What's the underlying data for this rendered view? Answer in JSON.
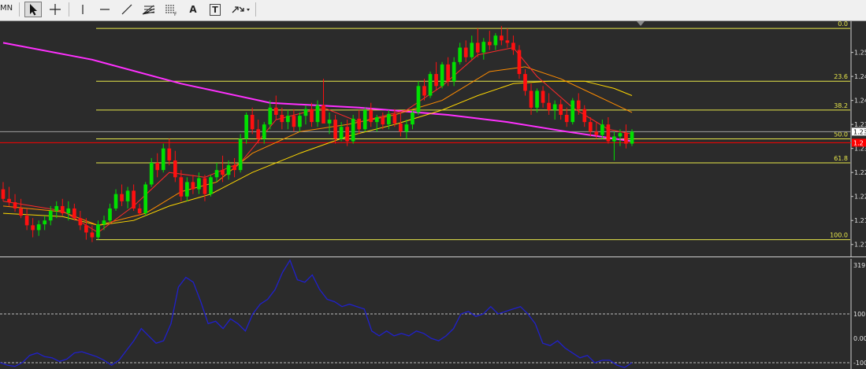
{
  "toolbar": {
    "timeframe_label": "MN",
    "tools": [
      {
        "name": "cursor-arrow-icon"
      },
      {
        "name": "crosshair-icon"
      },
      {
        "name": "vertical-line-icon"
      },
      {
        "name": "trendline-icon"
      },
      {
        "name": "fibonacci-fan-icon"
      },
      {
        "name": "fibonacci-retracement-icon"
      },
      {
        "name": "text-label-icon",
        "label": "A"
      },
      {
        "name": "text-box-icon",
        "label": "T"
      },
      {
        "name": "arrows-dropdown-icon"
      }
    ]
  },
  "colors": {
    "background": "#2b2b2b",
    "bull": "#00e000",
    "bear": "#ff1010",
    "fib": "#e8e84a",
    "ma_slow": "#ff30ff",
    "ma_mid": "#ffd800",
    "ma_fast": "#ff8c00",
    "ma_faster": "#ff2a2a",
    "indicator": "#2020cc",
    "current_price": "#ff0000",
    "ask_line": "#a0a0a0"
  },
  "chart_data": [
    {
      "type": "candlestick",
      "price_axis": {
        "range": [
          1.2085,
          1.257
        ],
        "tick_labels": [
          "1.25",
          "1.24",
          "1.24",
          "1.23",
          "1.23",
          "1.22",
          "1.22",
          "1.21",
          "1.21"
        ],
        "tick_values": [
          1.251,
          1.246,
          1.241,
          1.236,
          1.231,
          1.226,
          1.221,
          1.216,
          1.211
        ],
        "current_price_label": "1.2"
      },
      "current_price": 1.2322,
      "ask_price": 1.2345,
      "fibonacci": [
        {
          "label": "0.0",
          "price": 1.256
        },
        {
          "label": "23.6",
          "price": 1.245
        },
        {
          "label": "38.2",
          "price": 1.239
        },
        {
          "label": "50.0",
          "price": 1.233
        },
        {
          "label": "61.8",
          "price": 1.228
        },
        {
          "label": "100.0",
          "price": 1.212
        }
      ],
      "candles": [
        [
          1.2225,
          1.224,
          1.22,
          1.2205
        ],
        [
          1.2205,
          1.223,
          1.219,
          1.2198
        ],
        [
          1.2198,
          1.2215,
          1.2178,
          1.2185
        ],
        [
          1.2185,
          1.2205,
          1.2165,
          1.217
        ],
        [
          1.217,
          1.2185,
          1.214,
          1.215
        ],
        [
          1.215,
          1.2165,
          1.2125,
          1.214
        ],
        [
          1.214,
          1.216,
          1.2128,
          1.2152
        ],
        [
          1.2152,
          1.217,
          1.214,
          1.216
        ],
        [
          1.216,
          1.219,
          1.215,
          1.218
        ],
        [
          1.218,
          1.22,
          1.2165,
          1.219
        ],
        [
          1.219,
          1.2205,
          1.217,
          1.2175
        ],
        [
          1.2175,
          1.22,
          1.216,
          1.2185
        ],
        [
          1.2185,
          1.2195,
          1.216,
          1.2165
        ],
        [
          1.2165,
          1.218,
          1.214,
          1.215
        ],
        [
          1.215,
          1.2165,
          1.212,
          1.2135
        ],
        [
          1.2135,
          1.215,
          1.2115,
          1.2125
        ],
        [
          1.2125,
          1.216,
          1.212,
          1.2152
        ],
        [
          1.2152,
          1.217,
          1.214,
          1.216
        ],
        [
          1.216,
          1.2195,
          1.2155,
          1.2185
        ],
        [
          1.2185,
          1.2225,
          1.218,
          1.2215
        ],
        [
          1.2215,
          1.2235,
          1.219,
          1.22
        ],
        [
          1.22,
          1.223,
          1.2185,
          1.2222
        ],
        [
          1.2222,
          1.2235,
          1.218,
          1.2185
        ],
        [
          1.2185,
          1.2195,
          1.217,
          1.2175
        ],
        [
          1.2175,
          1.224,
          1.217,
          1.2235
        ],
        [
          1.2235,
          1.229,
          1.223,
          1.228
        ],
        [
          1.228,
          1.23,
          1.225,
          1.2265
        ],
        [
          1.2265,
          1.232,
          1.226,
          1.231
        ],
        [
          1.231,
          1.233,
          1.2275,
          1.2285
        ],
        [
          1.2285,
          1.2305,
          1.224,
          1.225
        ],
        [
          1.225,
          1.2265,
          1.22,
          1.221
        ],
        [
          1.221,
          1.225,
          1.22,
          1.224
        ],
        [
          1.224,
          1.2255,
          1.2215,
          1.2225
        ],
        [
          1.2225,
          1.226,
          1.2215,
          1.2248
        ],
        [
          1.2248,
          1.2255,
          1.22,
          1.2215
        ],
        [
          1.2215,
          1.2255,
          1.221,
          1.225
        ],
        [
          1.225,
          1.228,
          1.224,
          1.2265
        ],
        [
          1.2265,
          1.2295,
          1.224,
          1.2255
        ],
        [
          1.2255,
          1.2285,
          1.2245,
          1.2275
        ],
        [
          1.2275,
          1.229,
          1.225,
          1.2265
        ],
        [
          1.2265,
          1.234,
          1.226,
          1.233
        ],
        [
          1.233,
          1.2385,
          1.232,
          1.238
        ],
        [
          1.238,
          1.2395,
          1.234,
          1.235
        ],
        [
          1.235,
          1.237,
          1.232,
          1.233
        ],
        [
          1.233,
          1.2365,
          1.232,
          1.236
        ],
        [
          1.236,
          1.241,
          1.235,
          1.2395
        ],
        [
          1.2395,
          1.242,
          1.237,
          1.238
        ],
        [
          1.238,
          1.2395,
          1.235,
          1.2365
        ],
        [
          1.2365,
          1.239,
          1.235,
          1.2378
        ],
        [
          1.2378,
          1.2392,
          1.2345,
          1.2355
        ],
        [
          1.2355,
          1.2385,
          1.2345,
          1.2378
        ],
        [
          1.2378,
          1.24,
          1.236,
          1.2392
        ],
        [
          1.2392,
          1.2405,
          1.2355,
          1.2365
        ],
        [
          1.2365,
          1.241,
          1.2355,
          1.24
        ],
        [
          1.24,
          1.2455,
          1.2395,
          1.2362
        ],
        [
          1.2362,
          1.2385,
          1.234,
          1.237
        ],
        [
          1.237,
          1.238,
          1.232,
          1.233
        ],
        [
          1.233,
          1.2365,
          1.2325,
          1.2355
        ],
        [
          1.2355,
          1.237,
          1.2315,
          1.2325
        ],
        [
          1.2325,
          1.238,
          1.232,
          1.2372
        ],
        [
          1.2372,
          1.239,
          1.234,
          1.235
        ],
        [
          1.235,
          1.2395,
          1.2345,
          1.239
        ],
        [
          1.239,
          1.2405,
          1.2355,
          1.2365
        ],
        [
          1.2365,
          1.238,
          1.2345,
          1.2375
        ],
        [
          1.2375,
          1.2385,
          1.235,
          1.236
        ],
        [
          1.236,
          1.239,
          1.235,
          1.2382
        ],
        [
          1.2382,
          1.2392,
          1.2355,
          1.2362
        ],
        [
          1.2362,
          1.2385,
          1.2335,
          1.2345
        ],
        [
          1.2345,
          1.237,
          1.233,
          1.236
        ],
        [
          1.236,
          1.239,
          1.235,
          1.2385
        ],
        [
          1.2385,
          1.245,
          1.238,
          1.244
        ],
        [
          1.244,
          1.2455,
          1.241,
          1.242
        ],
        [
          1.242,
          1.247,
          1.2415,
          1.2465
        ],
        [
          1.2465,
          1.249,
          1.243,
          1.244
        ],
        [
          1.244,
          1.249,
          1.2435,
          1.2485
        ],
        [
          1.2485,
          1.25,
          1.244,
          1.245
        ],
        [
          1.245,
          1.25,
          1.244,
          1.249
        ],
        [
          1.249,
          1.253,
          1.2485,
          1.252
        ],
        [
          1.252,
          1.2535,
          1.249,
          1.25
        ],
        [
          1.25,
          1.2545,
          1.2495,
          1.253
        ],
        [
          1.253,
          1.256,
          1.25,
          1.251
        ],
        [
          1.251,
          1.254,
          1.2495,
          1.2532
        ],
        [
          1.2532,
          1.2555,
          1.2515,
          1.2525
        ],
        [
          1.2525,
          1.255,
          1.2515,
          1.2545
        ],
        [
          1.2545,
          1.2565,
          1.2525,
          1.2535
        ],
        [
          1.2535,
          1.256,
          1.252,
          1.253
        ],
        [
          1.253,
          1.2545,
          1.2505,
          1.2515
        ],
        [
          1.2515,
          1.2525,
          1.2455,
          1.2465
        ],
        [
          1.2465,
          1.2475,
          1.242,
          1.243
        ],
        [
          1.243,
          1.2445,
          1.238,
          1.2395
        ],
        [
          1.2395,
          1.2435,
          1.2385,
          1.243
        ],
        [
          1.243,
          1.244,
          1.2395,
          1.2405
        ],
        [
          1.2405,
          1.2425,
          1.238,
          1.239
        ],
        [
          1.239,
          1.241,
          1.237,
          1.2402
        ],
        [
          1.2402,
          1.2412,
          1.237,
          1.238
        ],
        [
          1.238,
          1.2395,
          1.2355,
          1.2365
        ],
        [
          1.2365,
          1.2415,
          1.236,
          1.241
        ],
        [
          1.241,
          1.2425,
          1.238,
          1.2392
        ],
        [
          1.2392,
          1.24,
          1.2355,
          1.2365
        ],
        [
          1.2365,
          1.2375,
          1.2335,
          1.2345
        ],
        [
          1.2345,
          1.2365,
          1.233,
          1.2338
        ],
        [
          1.2338,
          1.237,
          1.233,
          1.236
        ],
        [
          1.236,
          1.2375,
          1.232,
          1.2325
        ],
        [
          1.2325,
          1.2345,
          1.2285,
          1.2335
        ],
        [
          1.2335,
          1.235,
          1.2315,
          1.2342
        ],
        [
          1.2342,
          1.236,
          1.231,
          1.232
        ],
        [
          1.232,
          1.235,
          1.2315,
          1.2345
        ]
      ],
      "moving_averages": [
        {
          "name": "ma_slow",
          "points": [
            [
              0,
              1.253
            ],
            [
              15,
              1.2495
            ],
            [
              30,
              1.2445
            ],
            [
              45,
              1.2405
            ],
            [
              60,
              1.2395
            ],
            [
              75,
              1.238
            ],
            [
              85,
              1.2365
            ],
            [
              95,
              1.2345
            ],
            [
              106,
              1.2325
            ]
          ]
        },
        {
          "name": "ma_mid",
          "points": [
            [
              0,
              1.2175
            ],
            [
              10,
              1.2168
            ],
            [
              16,
              1.215
            ],
            [
              22,
              1.216
            ],
            [
              28,
              1.219
            ],
            [
              35,
              1.2215
            ],
            [
              42,
              1.226
            ],
            [
              50,
              1.23
            ],
            [
              58,
              1.2335
            ],
            [
              66,
              1.236
            ],
            [
              74,
              1.239
            ],
            [
              80,
              1.242
            ],
            [
              86,
              1.2445
            ],
            [
              92,
              1.245
            ],
            [
              98,
              1.245
            ],
            [
              103,
              1.2435
            ],
            [
              106,
              1.242
            ]
          ]
        },
        {
          "name": "ma_fast",
          "points": [
            [
              0,
              1.219
            ],
            [
              10,
              1.2178
            ],
            [
              16,
              1.215
            ],
            [
              24,
              1.2175
            ],
            [
              30,
              1.222
            ],
            [
              36,
              1.224
            ],
            [
              42,
              1.23
            ],
            [
              50,
              1.2345
            ],
            [
              58,
              1.236
            ],
            [
              66,
              1.238
            ],
            [
              74,
              1.241
            ],
            [
              82,
              1.247
            ],
            [
              88,
              1.248
            ],
            [
              94,
              1.2455
            ],
            [
              100,
              1.242
            ],
            [
              106,
              1.2385
            ]
          ]
        },
        {
          "name": "ma_faster",
          "points": [
            [
              0,
              1.22
            ],
            [
              10,
              1.218
            ],
            [
              16,
              1.2135
            ],
            [
              22,
              1.219
            ],
            [
              28,
              1.226
            ],
            [
              34,
              1.225
            ],
            [
              40,
              1.228
            ],
            [
              46,
              1.237
            ],
            [
              54,
              1.2395
            ],
            [
              60,
              1.2365
            ],
            [
              68,
              1.239
            ],
            [
              74,
              1.244
            ],
            [
              80,
              1.2505
            ],
            [
              86,
              1.252
            ],
            [
              90,
              1.246
            ],
            [
              96,
              1.2395
            ],
            [
              102,
              1.235
            ],
            [
              106,
              1.234
            ]
          ]
        }
      ]
    },
    {
      "type": "line",
      "name": "cci",
      "range": [
        -100,
        319
      ],
      "tick_labels": [
        "319.",
        "100",
        "0.00",
        "-100"
      ],
      "tick_values": [
        300,
        100,
        0,
        -100
      ],
      "levels": [
        100,
        -100
      ],
      "values": [
        -100,
        -110,
        -115,
        -100,
        -70,
        -60,
        -75,
        -80,
        -95,
        -85,
        -60,
        -55,
        -65,
        -75,
        -90,
        -110,
        -90,
        -50,
        -10,
        40,
        10,
        -20,
        -10,
        60,
        210,
        250,
        230,
        150,
        60,
        70,
        40,
        80,
        60,
        30,
        100,
        140,
        160,
        200,
        270,
        320,
        240,
        230,
        260,
        200,
        160,
        150,
        130,
        140,
        130,
        120,
        30,
        10,
        30,
        10,
        20,
        10,
        30,
        20,
        0,
        -10,
        10,
        40,
        100,
        110,
        90,
        100,
        130,
        100,
        110,
        120,
        130,
        100,
        60,
        -20,
        -30,
        -10,
        -40,
        -60,
        -80,
        -70,
        -100,
        -90,
        -90,
        -110,
        -120,
        -100
      ]
    }
  ]
}
